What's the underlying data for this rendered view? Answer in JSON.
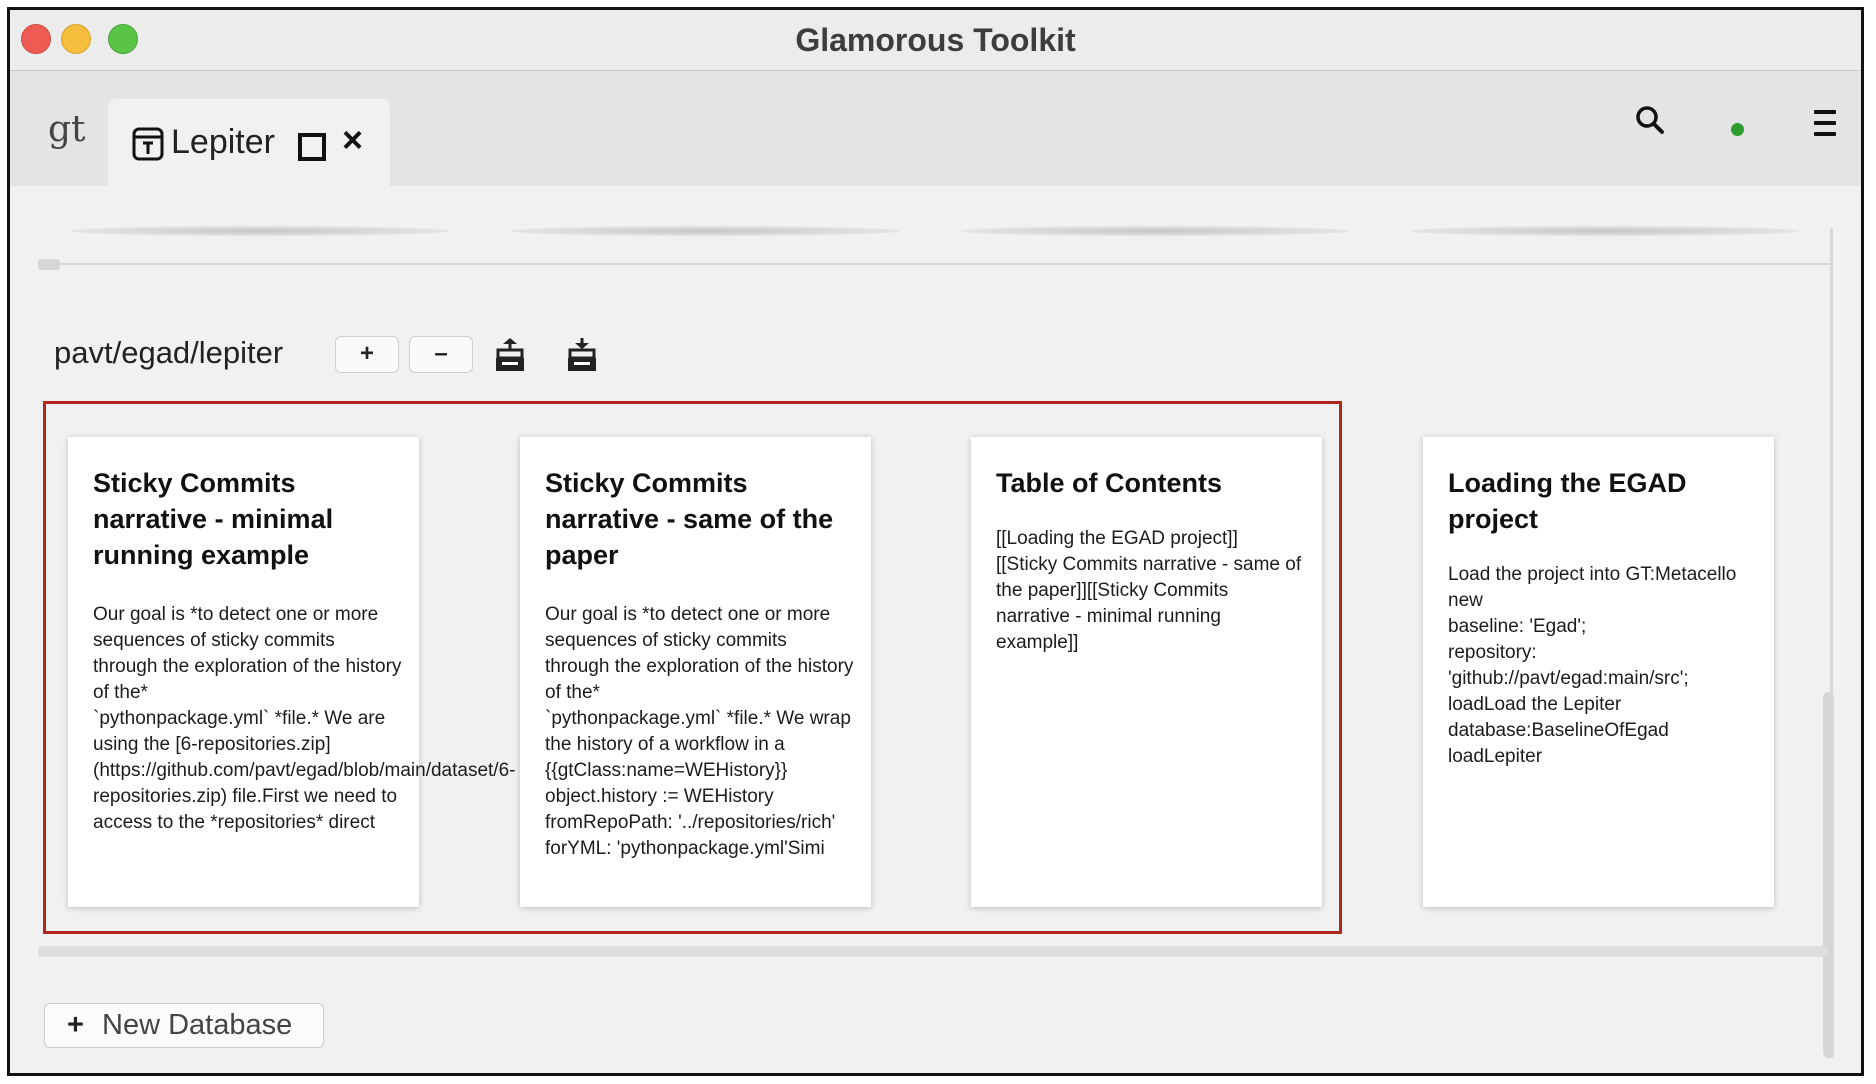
{
  "window": {
    "title": "Glamorous Toolkit"
  },
  "tabs": {
    "gt_label": "gt",
    "lepiter_label": "Lepiter",
    "close_glyph": "×"
  },
  "toolbar_icons": [
    "search-icon",
    "status-dot",
    "hamburger-menu-icon"
  ],
  "colors": {
    "status_dot": "#2e9c2e",
    "highlight_border": "#b3261e"
  },
  "database": {
    "path": "pavt/egad/lepiter",
    "plus_label": "+",
    "minus_label": "–",
    "icons": [
      "upload-icon",
      "download-icon"
    ]
  },
  "cards": [
    {
      "title": "Sticky Commits narrative - minimal running example",
      "body": "Our goal is *to detect one or more sequences of sticky commits through the exploration of the history of the*\n`pythonpackage.yml` *file.* We are using the [6-repositories.zip](https://github.com/pavt/egad/blob/main/dataset/6-repositories.zip) file.First we need to access to the *repositories* direct"
    },
    {
      "title": "Sticky Commits narrative - same of the paper",
      "body": "Our goal is *to detect one or more sequences of sticky commits through the exploration of the history of the*\n`pythonpackage.yml` *file.* We wrap the history of a workflow in a {{gtClass:name=WEHistory}} object.history := WEHistory fromRepoPath: '../repositories/rich' forYML: 'pythonpackage.yml'Simi"
    },
    {
      "title": "Table of Contents",
      "body": "[[Loading the EGAD project]]\n[[Sticky Commits narrative - same of the paper]][[Sticky Commits narrative - minimal running example]]"
    },
    {
      "title": "Loading the EGAD project",
      "body": "Load the project into GT:Metacello new\n   baseline: 'Egad';\n   repository: 'github://pavt/egad:main/src';\n   loadLoad the Lepiter database:BaselineOfEgad loadLepiter"
    }
  ],
  "footer": {
    "new_db_plus": "+",
    "new_db_label": "New Database"
  }
}
